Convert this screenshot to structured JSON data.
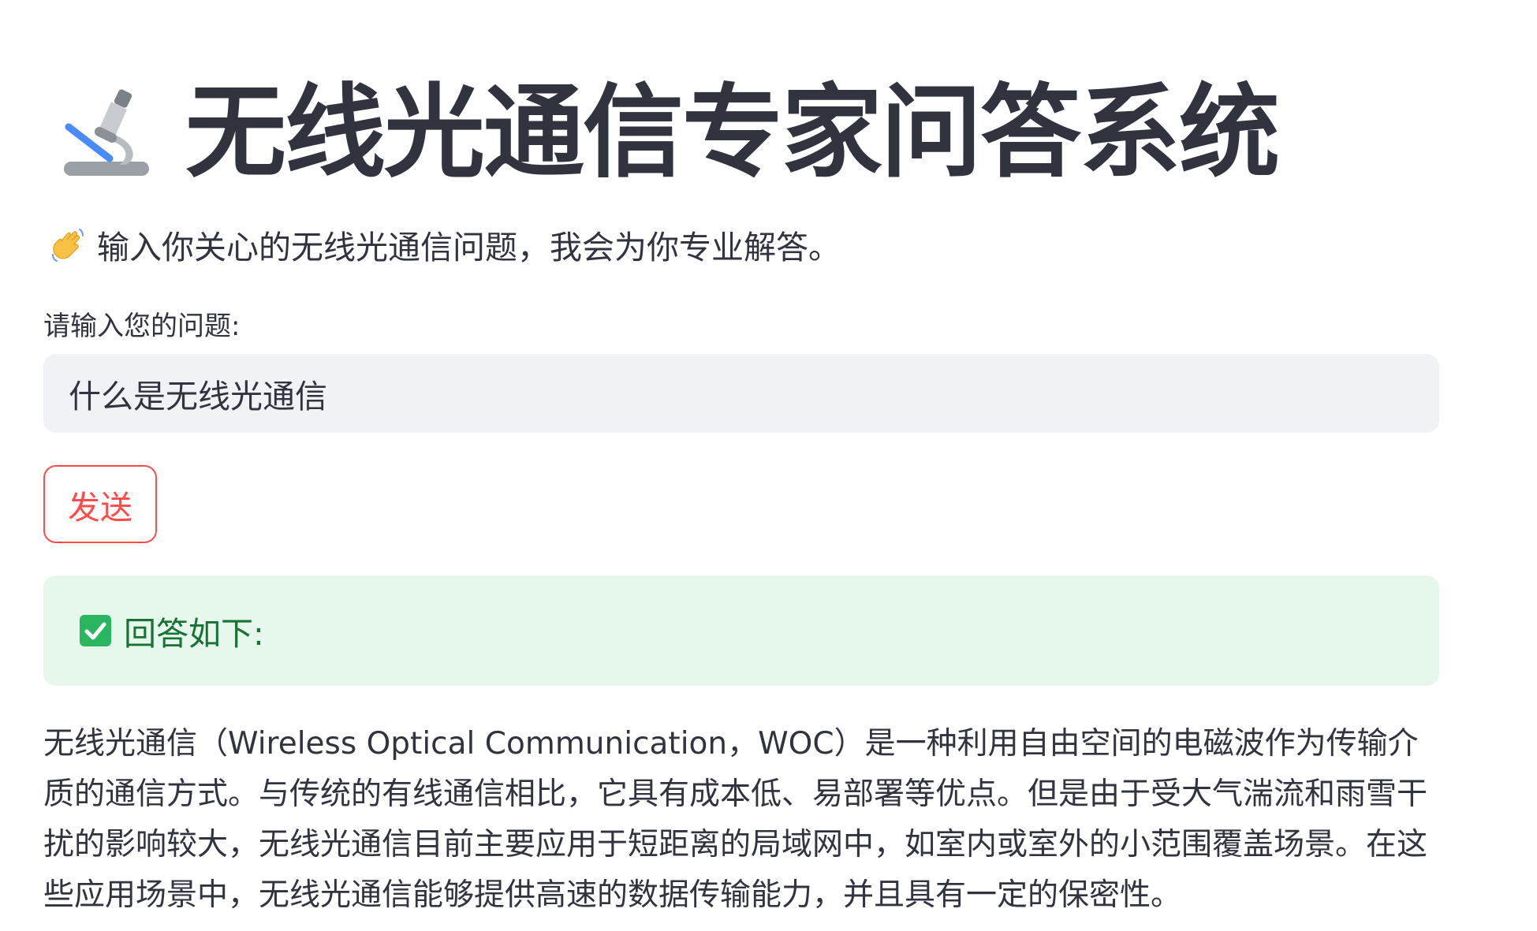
{
  "header": {
    "icon": "microscope-icon",
    "title": "无线光通信专家问答系统"
  },
  "subtitle": {
    "icon": "waving-hand-icon",
    "text": "输入你关心的无线光通信问题，我会为你专业解答。"
  },
  "question": {
    "label": "请输入您的问题:",
    "value": "什么是无线光通信"
  },
  "send_button": {
    "label": "发送"
  },
  "result": {
    "icon": "check-icon",
    "status": "回答如下:",
    "answer": "无线光通信（Wireless Optical Communication，WOC）是一种利用自由空间的电磁波作为传输介质的通信方式。与传统的有线通信相比，它具有成本低、易部署等优点。但是由于受大气湍流和雨雪干扰的影响较大，无线光通信目前主要应用于短距离的局域网中，如室内或室外的小范围覆盖场景。在这些应用场景中，无线光通信能够提供高速的数据传输能力，并且具有一定的保密性。"
  },
  "colors": {
    "text": "#31333f",
    "accent": "#ff4b4b",
    "success_bg": "#e6f8ec",
    "success_text": "#177233",
    "input_bg": "#f0f2f6"
  }
}
